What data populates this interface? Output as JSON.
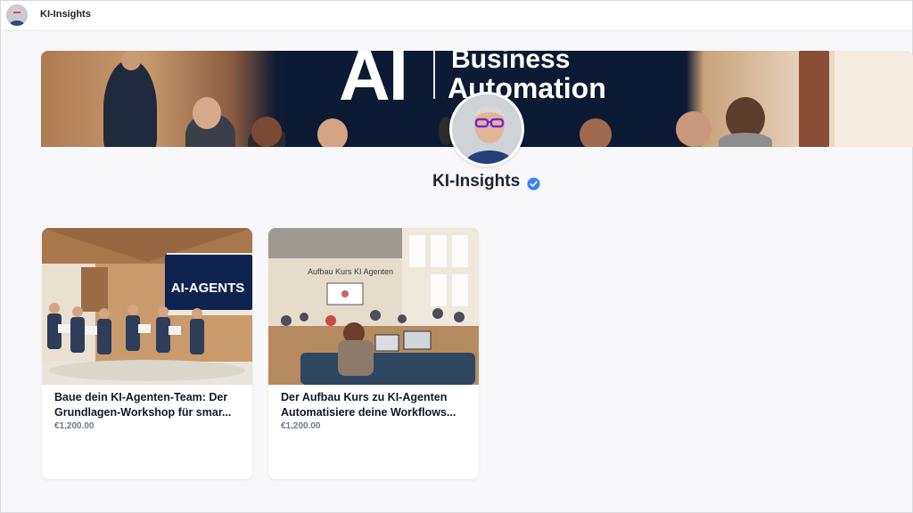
{
  "app": {
    "title": "KI-Insights"
  },
  "banner": {
    "screen_big": "AI",
    "screen_line1": "Business",
    "screen_line2": "Automation"
  },
  "profile": {
    "name": "KI-Insights",
    "verified": true
  },
  "colors": {
    "accent": "#3b82f6",
    "price": "#6b7a8f",
    "title": "#111827"
  },
  "products": [
    {
      "title_line1": "Baue dein KI-Agenten-Team: Der",
      "title_line2": "Grundlagen-Workshop für smar...",
      "price": "€1,200.00",
      "image_text": "AI-AGENTS"
    },
    {
      "title_line1": "Der Aufbau Kurs zu KI-Agenten",
      "title_line2": "Automatisiere deine Workflows...",
      "price": "€1,200.00",
      "image_text": "Aufbau Kurs KI Agenten"
    }
  ]
}
